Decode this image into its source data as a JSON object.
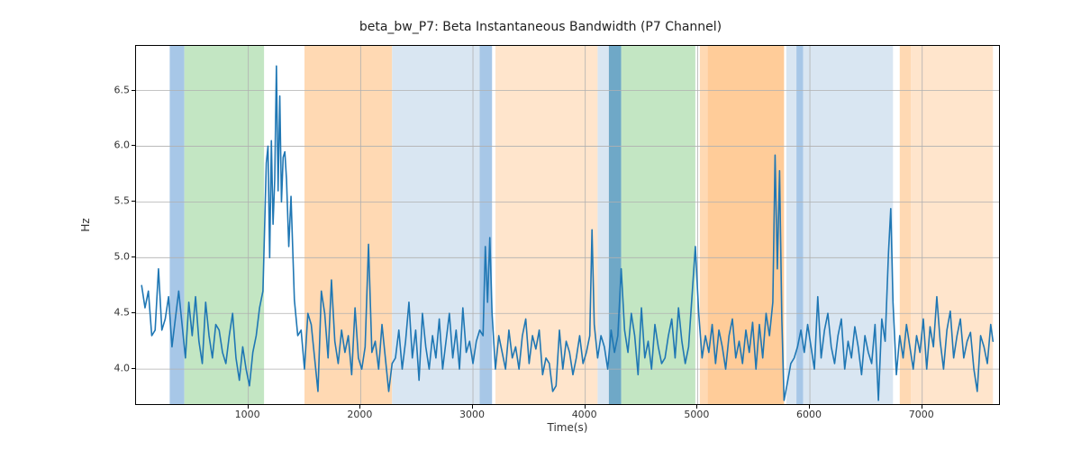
{
  "chart_data": {
    "type": "line",
    "title": "beta_bw_P7: Beta Instantaneous Bandwidth (P7 Channel)",
    "xlabel": "Time(s)",
    "ylabel": "Hz",
    "xlim": [
      0,
      7700
    ],
    "ylim": [
      3.67,
      6.9
    ],
    "x_ticks": [
      1000,
      2000,
      3000,
      4000,
      5000,
      6000,
      7000
    ],
    "y_ticks": [
      4.0,
      4.5,
      5.0,
      5.5,
      6.0,
      6.5
    ],
    "line_color": "#1f77b4",
    "bands": [
      {
        "x0": 300,
        "x1": 430,
        "color": "#a7c7e7"
      },
      {
        "x0": 430,
        "x1": 1140,
        "color": "#c3e6c3"
      },
      {
        "x0": 1500,
        "x1": 2280,
        "color": "#ffd9b3"
      },
      {
        "x0": 2280,
        "x1": 3060,
        "color": "#d9e6f2"
      },
      {
        "x0": 3060,
        "x1": 3170,
        "color": "#a7c7e7"
      },
      {
        "x0": 3200,
        "x1": 4110,
        "color": "#ffe5cc"
      },
      {
        "x0": 4110,
        "x1": 4210,
        "color": "#d9e6f2"
      },
      {
        "x0": 4210,
        "x1": 4320,
        "color": "#6fa8c7"
      },
      {
        "x0": 4320,
        "x1": 4980,
        "color": "#c3e6c3"
      },
      {
        "x0": 5020,
        "x1": 5090,
        "color": "#ffd9b3"
      },
      {
        "x0": 5090,
        "x1": 5770,
        "color": "#ffcc99"
      },
      {
        "x0": 5790,
        "x1": 5880,
        "color": "#d9e6f2"
      },
      {
        "x0": 5880,
        "x1": 5940,
        "color": "#a7c7e7"
      },
      {
        "x0": 5940,
        "x1": 6740,
        "color": "#d9e6f2"
      },
      {
        "x0": 6800,
        "x1": 6900,
        "color": "#ffd9b3"
      },
      {
        "x0": 6900,
        "x1": 7630,
        "color": "#ffe5cc"
      }
    ],
    "series": [
      {
        "name": "beta_bw_P7",
        "data": [
          [
            50,
            4.75
          ],
          [
            80,
            4.55
          ],
          [
            110,
            4.7
          ],
          [
            140,
            4.3
          ],
          [
            170,
            4.35
          ],
          [
            200,
            4.9
          ],
          [
            230,
            4.35
          ],
          [
            260,
            4.45
          ],
          [
            290,
            4.65
          ],
          [
            320,
            4.2
          ],
          [
            350,
            4.45
          ],
          [
            380,
            4.7
          ],
          [
            410,
            4.4
          ],
          [
            440,
            4.1
          ],
          [
            470,
            4.6
          ],
          [
            500,
            4.3
          ],
          [
            530,
            4.65
          ],
          [
            560,
            4.25
          ],
          [
            590,
            4.05
          ],
          [
            620,
            4.6
          ],
          [
            650,
            4.3
          ],
          [
            680,
            4.1
          ],
          [
            710,
            4.4
          ],
          [
            740,
            4.35
          ],
          [
            770,
            4.15
          ],
          [
            800,
            4.05
          ],
          [
            830,
            4.3
          ],
          [
            860,
            4.5
          ],
          [
            890,
            4.1
          ],
          [
            920,
            3.9
          ],
          [
            950,
            4.2
          ],
          [
            980,
            4.0
          ],
          [
            1010,
            3.85
          ],
          [
            1040,
            4.15
          ],
          [
            1070,
            4.3
          ],
          [
            1100,
            4.55
          ],
          [
            1130,
            4.7
          ],
          [
            1160,
            5.85
          ],
          [
            1175,
            6.0
          ],
          [
            1190,
            5.0
          ],
          [
            1205,
            6.05
          ],
          [
            1220,
            5.3
          ],
          [
            1235,
            5.7
          ],
          [
            1250,
            6.72
          ],
          [
            1265,
            5.6
          ],
          [
            1280,
            6.45
          ],
          [
            1295,
            5.5
          ],
          [
            1310,
            5.9
          ],
          [
            1325,
            5.95
          ],
          [
            1340,
            5.7
          ],
          [
            1360,
            5.1
          ],
          [
            1380,
            5.55
          ],
          [
            1410,
            4.62
          ],
          [
            1440,
            4.3
          ],
          [
            1470,
            4.35
          ],
          [
            1500,
            4.0
          ],
          [
            1530,
            4.5
          ],
          [
            1560,
            4.4
          ],
          [
            1590,
            4.1
          ],
          [
            1620,
            3.8
          ],
          [
            1650,
            4.7
          ],
          [
            1680,
            4.5
          ],
          [
            1710,
            4.1
          ],
          [
            1740,
            4.8
          ],
          [
            1770,
            4.25
          ],
          [
            1800,
            4.05
          ],
          [
            1830,
            4.35
          ],
          [
            1860,
            4.15
          ],
          [
            1890,
            4.3
          ],
          [
            1920,
            3.95
          ],
          [
            1950,
            4.55
          ],
          [
            1980,
            4.1
          ],
          [
            2010,
            4.0
          ],
          [
            2040,
            4.2
          ],
          [
            2070,
            5.12
          ],
          [
            2100,
            4.15
          ],
          [
            2130,
            4.25
          ],
          [
            2160,
            4.0
          ],
          [
            2190,
            4.4
          ],
          [
            2220,
            4.1
          ],
          [
            2250,
            3.8
          ],
          [
            2280,
            4.05
          ],
          [
            2310,
            4.1
          ],
          [
            2340,
            4.35
          ],
          [
            2370,
            4.0
          ],
          [
            2400,
            4.25
          ],
          [
            2430,
            4.6
          ],
          [
            2460,
            4.1
          ],
          [
            2490,
            4.35
          ],
          [
            2520,
            3.9
          ],
          [
            2550,
            4.5
          ],
          [
            2580,
            4.2
          ],
          [
            2610,
            4.0
          ],
          [
            2640,
            4.3
          ],
          [
            2670,
            4.1
          ],
          [
            2700,
            4.45
          ],
          [
            2730,
            4.0
          ],
          [
            2760,
            4.25
          ],
          [
            2790,
            4.5
          ],
          [
            2820,
            4.1
          ],
          [
            2850,
            4.35
          ],
          [
            2880,
            4.0
          ],
          [
            2910,
            4.55
          ],
          [
            2940,
            4.15
          ],
          [
            2970,
            4.25
          ],
          [
            3000,
            4.05
          ],
          [
            3030,
            4.25
          ],
          [
            3060,
            4.35
          ],
          [
            3090,
            4.3
          ],
          [
            3110,
            5.1
          ],
          [
            3130,
            4.6
          ],
          [
            3150,
            5.18
          ],
          [
            3170,
            4.5
          ],
          [
            3200,
            4.0
          ],
          [
            3230,
            4.3
          ],
          [
            3260,
            4.15
          ],
          [
            3290,
            4.0
          ],
          [
            3320,
            4.35
          ],
          [
            3350,
            4.1
          ],
          [
            3380,
            4.2
          ],
          [
            3410,
            4.0
          ],
          [
            3440,
            4.3
          ],
          [
            3470,
            4.45
          ],
          [
            3500,
            4.05
          ],
          [
            3530,
            4.3
          ],
          [
            3560,
            4.18
          ],
          [
            3590,
            4.35
          ],
          [
            3620,
            3.95
          ],
          [
            3650,
            4.1
          ],
          [
            3680,
            4.05
          ],
          [
            3710,
            3.8
          ],
          [
            3740,
            3.85
          ],
          [
            3770,
            4.35
          ],
          [
            3800,
            4.0
          ],
          [
            3830,
            4.25
          ],
          [
            3860,
            4.15
          ],
          [
            3890,
            3.95
          ],
          [
            3920,
            4.1
          ],
          [
            3950,
            4.3
          ],
          [
            3980,
            4.05
          ],
          [
            4010,
            4.15
          ],
          [
            4040,
            4.3
          ],
          [
            4060,
            5.25
          ],
          [
            4080,
            4.4
          ],
          [
            4110,
            4.1
          ],
          [
            4140,
            4.3
          ],
          [
            4170,
            4.2
          ],
          [
            4200,
            4.0
          ],
          [
            4230,
            4.35
          ],
          [
            4260,
            4.15
          ],
          [
            4290,
            4.3
          ],
          [
            4320,
            4.9
          ],
          [
            4350,
            4.35
          ],
          [
            4380,
            4.15
          ],
          [
            4410,
            4.5
          ],
          [
            4440,
            4.3
          ],
          [
            4470,
            3.95
          ],
          [
            4500,
            4.55
          ],
          [
            4530,
            4.1
          ],
          [
            4560,
            4.25
          ],
          [
            4590,
            4.0
          ],
          [
            4620,
            4.4
          ],
          [
            4650,
            4.2
          ],
          [
            4680,
            4.05
          ],
          [
            4710,
            4.1
          ],
          [
            4740,
            4.3
          ],
          [
            4770,
            4.45
          ],
          [
            4800,
            4.1
          ],
          [
            4830,
            4.55
          ],
          [
            4860,
            4.25
          ],
          [
            4890,
            4.05
          ],
          [
            4920,
            4.2
          ],
          [
            4950,
            4.65
          ],
          [
            4980,
            5.1
          ],
          [
            5010,
            4.5
          ],
          [
            5040,
            4.1
          ],
          [
            5070,
            4.3
          ],
          [
            5100,
            4.15
          ],
          [
            5130,
            4.4
          ],
          [
            5160,
            4.05
          ],
          [
            5190,
            4.35
          ],
          [
            5220,
            4.2
          ],
          [
            5250,
            4.0
          ],
          [
            5280,
            4.3
          ],
          [
            5310,
            4.45
          ],
          [
            5340,
            4.1
          ],
          [
            5370,
            4.25
          ],
          [
            5400,
            4.05
          ],
          [
            5430,
            4.35
          ],
          [
            5460,
            4.15
          ],
          [
            5490,
            4.42
          ],
          [
            5520,
            4.0
          ],
          [
            5550,
            4.4
          ],
          [
            5580,
            4.1
          ],
          [
            5610,
            4.5
          ],
          [
            5640,
            4.3
          ],
          [
            5670,
            4.6
          ],
          [
            5690,
            5.92
          ],
          [
            5710,
            4.9
          ],
          [
            5730,
            5.78
          ],
          [
            5750,
            4.45
          ],
          [
            5770,
            3.72
          ],
          [
            5800,
            3.88
          ],
          [
            5830,
            4.05
          ],
          [
            5860,
            4.1
          ],
          [
            5890,
            4.2
          ],
          [
            5920,
            4.35
          ],
          [
            5950,
            4.15
          ],
          [
            5980,
            4.4
          ],
          [
            6010,
            4.2
          ],
          [
            6040,
            4.0
          ],
          [
            6070,
            4.65
          ],
          [
            6100,
            4.1
          ],
          [
            6130,
            4.35
          ],
          [
            6160,
            4.5
          ],
          [
            6190,
            4.2
          ],
          [
            6220,
            4.05
          ],
          [
            6250,
            4.3
          ],
          [
            6280,
            4.45
          ],
          [
            6310,
            4.0
          ],
          [
            6340,
            4.25
          ],
          [
            6370,
            4.1
          ],
          [
            6400,
            4.38
          ],
          [
            6430,
            4.2
          ],
          [
            6460,
            3.95
          ],
          [
            6490,
            4.3
          ],
          [
            6520,
            4.15
          ],
          [
            6550,
            4.05
          ],
          [
            6580,
            4.4
          ],
          [
            6610,
            3.72
          ],
          [
            6640,
            4.45
          ],
          [
            6670,
            4.25
          ],
          [
            6700,
            5.05
          ],
          [
            6720,
            5.44
          ],
          [
            6740,
            4.6
          ],
          [
            6770,
            3.95
          ],
          [
            6800,
            4.3
          ],
          [
            6830,
            4.1
          ],
          [
            6860,
            4.4
          ],
          [
            6890,
            4.2
          ],
          [
            6920,
            4.0
          ],
          [
            6950,
            4.3
          ],
          [
            6980,
            4.15
          ],
          [
            7010,
            4.45
          ],
          [
            7040,
            4.0
          ],
          [
            7070,
            4.38
          ],
          [
            7100,
            4.2
          ],
          [
            7130,
            4.65
          ],
          [
            7160,
            4.25
          ],
          [
            7190,
            4.0
          ],
          [
            7220,
            4.35
          ],
          [
            7250,
            4.52
          ],
          [
            7280,
            4.1
          ],
          [
            7310,
            4.3
          ],
          [
            7340,
            4.45
          ],
          [
            7370,
            4.1
          ],
          [
            7400,
            4.25
          ],
          [
            7430,
            4.33
          ],
          [
            7460,
            4.0
          ],
          [
            7490,
            3.8
          ],
          [
            7520,
            4.3
          ],
          [
            7550,
            4.2
          ],
          [
            7580,
            4.05
          ],
          [
            7610,
            4.4
          ],
          [
            7630,
            4.25
          ]
        ]
      }
    ]
  }
}
